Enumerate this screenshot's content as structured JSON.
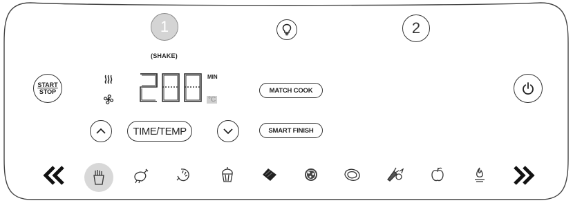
{
  "zones": {
    "zone1": "1",
    "zone2": "2",
    "shake_label": "(SHAKE)"
  },
  "buttons": {
    "start_stop_line1": "START",
    "start_stop_line2": "STOP",
    "match_cook": "MATCH COOK",
    "smart_finish": "SMART FINISH",
    "time_temp": "TIME/TEMP"
  },
  "display": {
    "digits": "200",
    "unit_min": "MIN",
    "unit_celsius": "°C",
    "heat_icon": "heat-waves-icon",
    "fan_icon": "fan-icon"
  },
  "icons": {
    "light": "lightbulb-icon",
    "power": "power-icon",
    "up": "chevron-up-icon",
    "down": "chevron-down-icon",
    "prev": "double-chevron-left-icon",
    "next": "double-chevron-right-icon"
  },
  "presets": [
    {
      "icon": "fries-icon",
      "selected": true
    },
    {
      "icon": "chicken-drumstick-icon",
      "selected": false
    },
    {
      "icon": "shrimp-icon",
      "selected": false
    },
    {
      "icon": "cupcake-icon",
      "selected": false
    },
    {
      "icon": "bacon-icon",
      "selected": false
    },
    {
      "icon": "pizza-icon",
      "selected": false
    },
    {
      "icon": "steak-icon",
      "selected": false
    },
    {
      "icon": "vegetables-icon",
      "selected": false
    },
    {
      "icon": "apple-icon",
      "selected": false
    },
    {
      "icon": "flame-icon",
      "selected": false
    }
  ],
  "colors": {
    "outline": "#333333",
    "selected_fill": "#d8d8d8",
    "zone1_fill": "#d4d4d4"
  }
}
